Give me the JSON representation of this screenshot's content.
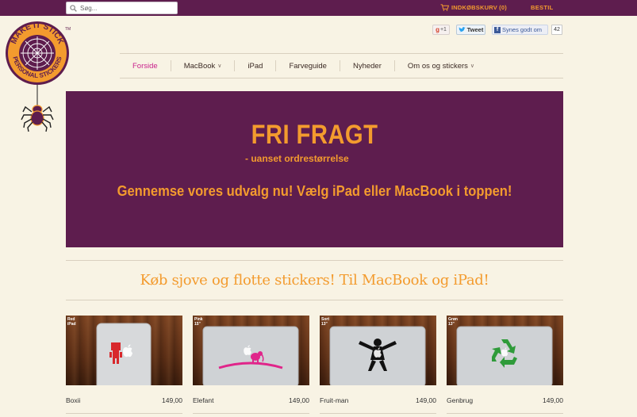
{
  "topbar": {
    "search_placeholder": "Søg...",
    "cart_label": "INDKØBSKURV (0)",
    "order_label": "BESTIL"
  },
  "logo": {
    "brand_top": "MAKE IT STICK",
    "brand_bottom": "PERSONAL STICKERS",
    "trademark": "TM"
  },
  "social": {
    "gplus_label": "+1",
    "tweet_label": "Tweet",
    "facebook_label": "Synes godt om",
    "facebook_count": "42"
  },
  "nav": [
    {
      "label": "Forside",
      "active": true,
      "dropdown": false
    },
    {
      "label": "MacBook",
      "active": false,
      "dropdown": true
    },
    {
      "label": "iPad",
      "active": false,
      "dropdown": false
    },
    {
      "label": "Farveguide",
      "active": false,
      "dropdown": false
    },
    {
      "label": "Nyheder",
      "active": false,
      "dropdown": false
    },
    {
      "label": "Om os og stickers",
      "active": false,
      "dropdown": true
    }
  ],
  "banner": {
    "headline": "FRI FRAGT",
    "subline": "- uanset ordrestørrelse",
    "cta": "Gennemse vores udvalg nu! Vælg iPad eller MacBook i toppen!"
  },
  "section_heading": "Køb sjove og flotte stickers! Til MacBook og iPad!",
  "products": [
    {
      "name": "Boxii",
      "price": "149,00",
      "tag_color": "Red",
      "tag_size": "iPad",
      "device": "ipad",
      "sticker": "robot",
      "sticker_color": "#d8282c"
    },
    {
      "name": "Elefant",
      "price": "149,00",
      "tag_color": "Pink",
      "tag_size": "15\"",
      "device": "macbook",
      "sticker": "elephant",
      "sticker_color": "#e0258a"
    },
    {
      "name": "Fruit-man",
      "price": "149,00",
      "tag_color": "Sort",
      "tag_size": "13\"",
      "device": "macbook",
      "sticker": "superhero",
      "sticker_color": "#111111"
    },
    {
      "name": "Genbrug",
      "price": "149,00",
      "tag_color": "Grøn",
      "tag_size": "13\"",
      "device": "macbook",
      "sticker": "recycle",
      "sticker_color": "#2f9b3a"
    }
  ],
  "colors": {
    "brand_purple": "#5e1d4e",
    "accent_orange": "#f39b2e",
    "nav_active": "#c9228c",
    "background": "#f8f3e4"
  }
}
